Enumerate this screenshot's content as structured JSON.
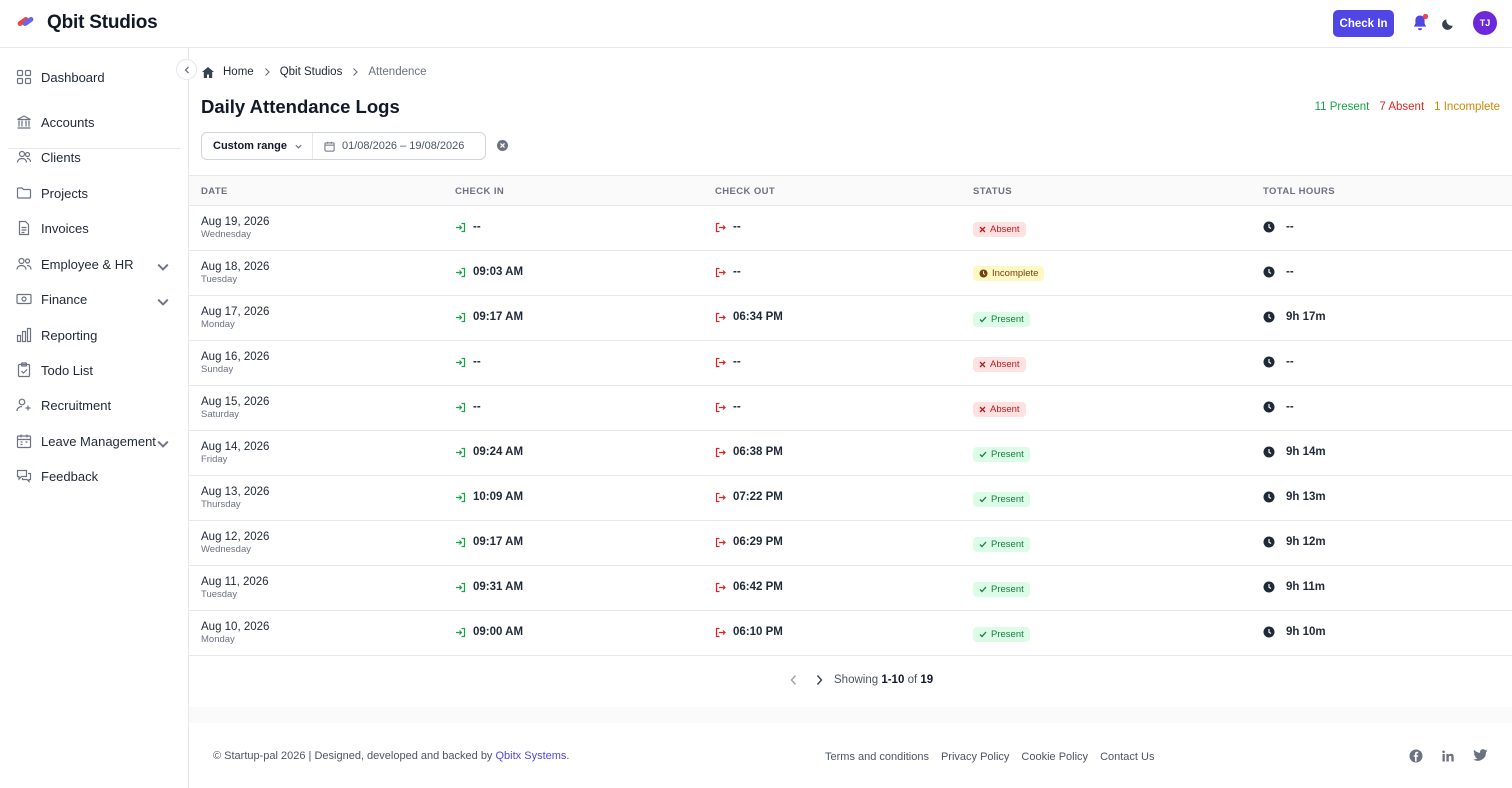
{
  "app": {
    "title": "Qbit Studios"
  },
  "header": {
    "checkin_label": "Check In",
    "avatar_initials": "TJ",
    "accent": "#4f46e5"
  },
  "sidebar": {
    "items": [
      {
        "label": "Dashboard",
        "icon": "dashboard-icon"
      },
      {
        "label": "Accounts",
        "icon": "bank-icon"
      },
      {
        "label": "Clients",
        "icon": "users-icon"
      },
      {
        "label": "Projects",
        "icon": "folder-icon"
      },
      {
        "label": "Invoices",
        "icon": "document-icon"
      },
      {
        "label": "Employee & HR",
        "icon": "user-group-icon",
        "expandable": true
      },
      {
        "label": "Finance",
        "icon": "banknote-icon",
        "expandable": true
      },
      {
        "label": "Reporting",
        "icon": "bar-chart-icon"
      },
      {
        "label": "Todo List",
        "icon": "clipboard-check-icon"
      },
      {
        "label": "Recruitment",
        "icon": "user-plus-icon"
      },
      {
        "label": "Leave Management",
        "icon": "calendar-icon",
        "expandable": true
      },
      {
        "label": "Feedback",
        "icon": "chat-bubbles-icon"
      }
    ]
  },
  "breadcrumb": {
    "home": "Home",
    "org": "Qbit Studios",
    "current": "Attendence"
  },
  "page": {
    "title": "Daily Attendance Logs",
    "summary": {
      "present": "11 Present",
      "absent": "7 Absent",
      "incomplete": "1 Incomplete"
    }
  },
  "filter": {
    "range_label": "Custom range",
    "date_range": "01/08/2026 – 19/08/2026"
  },
  "table": {
    "headers": {
      "date": "DATE",
      "check_in": "CHECK IN",
      "check_out": "CHECK OUT",
      "status": "STATUS",
      "total_hours": "TOTAL HOURS"
    },
    "rows": [
      {
        "date": "Aug 19, 2026",
        "day": "Wednesday",
        "in": "--",
        "out": "--",
        "status": "Absent",
        "status_type": "absent",
        "hours": "--"
      },
      {
        "date": "Aug 18, 2026",
        "day": "Tuesday",
        "in": "09:03 AM",
        "out": "--",
        "status": "Incomplete",
        "status_type": "incomplete",
        "hours": "--"
      },
      {
        "date": "Aug 17, 2026",
        "day": "Monday",
        "in": "09:17 AM",
        "out": "06:34 PM",
        "status": "Present",
        "status_type": "present",
        "hours": "9h 17m"
      },
      {
        "date": "Aug 16, 2026",
        "day": "Sunday",
        "in": "--",
        "out": "--",
        "status": "Absent",
        "status_type": "absent",
        "hours": "--"
      },
      {
        "date": "Aug 15, 2026",
        "day": "Saturday",
        "in": "--",
        "out": "--",
        "status": "Absent",
        "status_type": "absent",
        "hours": "--"
      },
      {
        "date": "Aug 14, 2026",
        "day": "Friday",
        "in": "09:24 AM",
        "out": "06:38 PM",
        "status": "Present",
        "status_type": "present",
        "hours": "9h 14m"
      },
      {
        "date": "Aug 13, 2026",
        "day": "Thursday",
        "in": "10:09 AM",
        "out": "07:22 PM",
        "status": "Present",
        "status_type": "present",
        "hours": "9h 13m"
      },
      {
        "date": "Aug 12, 2026",
        "day": "Wednesday",
        "in": "09:17 AM",
        "out": "06:29 PM",
        "status": "Present",
        "status_type": "present",
        "hours": "9h 12m"
      },
      {
        "date": "Aug 11, 2026",
        "day": "Tuesday",
        "in": "09:31 AM",
        "out": "06:42 PM",
        "status": "Present",
        "status_type": "present",
        "hours": "9h 11m"
      },
      {
        "date": "Aug 10, 2026",
        "day": "Monday",
        "in": "09:00 AM",
        "out": "06:10 PM",
        "status": "Present",
        "status_type": "present",
        "hours": "9h 10m"
      }
    ]
  },
  "pagination": {
    "prefix": "Showing",
    "range": "1-10",
    "of": "of",
    "total": "19"
  },
  "footer": {
    "copyright_prefix": "© Startup-pal 2026 | Designed, developed and backed by",
    "brand_link": "Qbitx Systems",
    "brand_suffix": ".",
    "links": [
      "Terms and conditions",
      "Privacy Policy",
      "Cookie Policy",
      "Contact Us"
    ],
    "socials": [
      "facebook-icon",
      "linkedin-icon",
      "twitter-icon"
    ]
  }
}
